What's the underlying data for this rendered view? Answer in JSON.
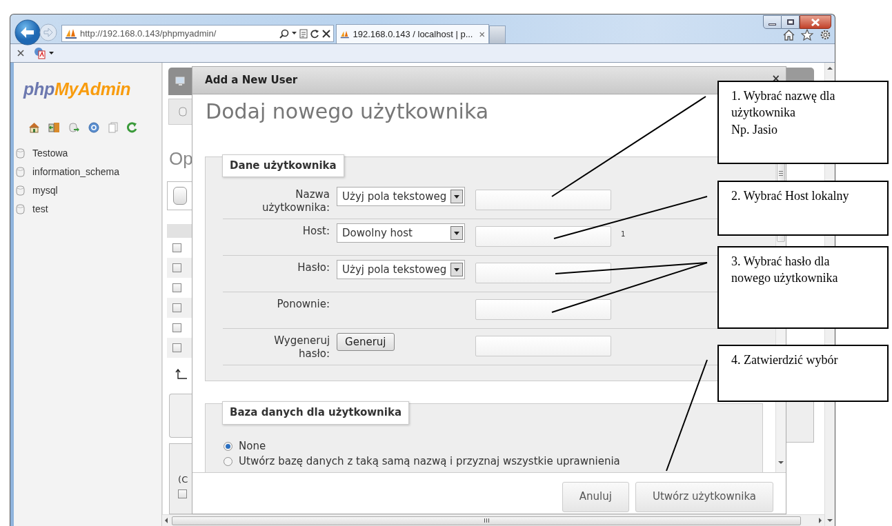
{
  "browser": {
    "address": "http://192.168.0.143/phpmyadmin/",
    "tabs": [
      {
        "title": "192.168.0.143 / localhost | p...",
        "selected": true
      }
    ]
  },
  "sidebar": {
    "logo": {
      "part_1": "php",
      "part_2": "MyAdmin"
    },
    "databases": [
      {
        "name": "Testowa"
      },
      {
        "name": "information_schema"
      },
      {
        "name": "mysql"
      },
      {
        "name": "test"
      }
    ]
  },
  "background_page": {
    "heading_fragment": "Op",
    "checkboxes": [
      {
        "checked": false
      },
      {
        "checked": false
      },
      {
        "checked": false
      },
      {
        "checked": false
      },
      {
        "checked": false
      },
      {
        "checked": false
      }
    ],
    "fragment": "(C",
    "bottom_checkbox": {
      "checked": false
    }
  },
  "dialog": {
    "title": "Add a New User",
    "close": "×",
    "heading": "Dodaj nowego użytkownika",
    "login_section": {
      "legend": "Dane użytkownika",
      "rows": [
        {
          "kind": "select",
          "label": "Nazwa użytkownika:",
          "select": "Użyj pola tekstoweg"
        },
        {
          "kind": "select",
          "label": "Host:",
          "select": "Dowolny host",
          "note": "1"
        },
        {
          "kind": "select",
          "label": "Hasło:",
          "select": "Użyj pola tekstoweg"
        },
        {
          "kind": "plain",
          "label": "Ponownie:"
        },
        {
          "kind": "button",
          "label": "Wygeneruj hasło:",
          "button": "Generuj"
        }
      ]
    },
    "database_section": {
      "legend": "Baza danych dla użytkownika",
      "options": [
        {
          "label": "None",
          "selected": true
        },
        {
          "label": "Utwórz bazę danych z taką samą nazwą i przyznaj wszystkie uprawnienia",
          "selected": false
        }
      ]
    },
    "buttons": [
      {
        "label": "Anuluj"
      },
      {
        "label": "Utwórz użytkownika"
      }
    ]
  },
  "callouts": [
    {
      "text": "1. Wybrać nazwę dla\nużytkownika\nNp. Jasio"
    },
    {
      "text": "2. Wybrać Host lokalny"
    },
    {
      "text": "3. Wybrać hasło dla\nnowego użytkownika"
    },
    {
      "text": "4. Zatwierdzić wybór"
    }
  ]
}
